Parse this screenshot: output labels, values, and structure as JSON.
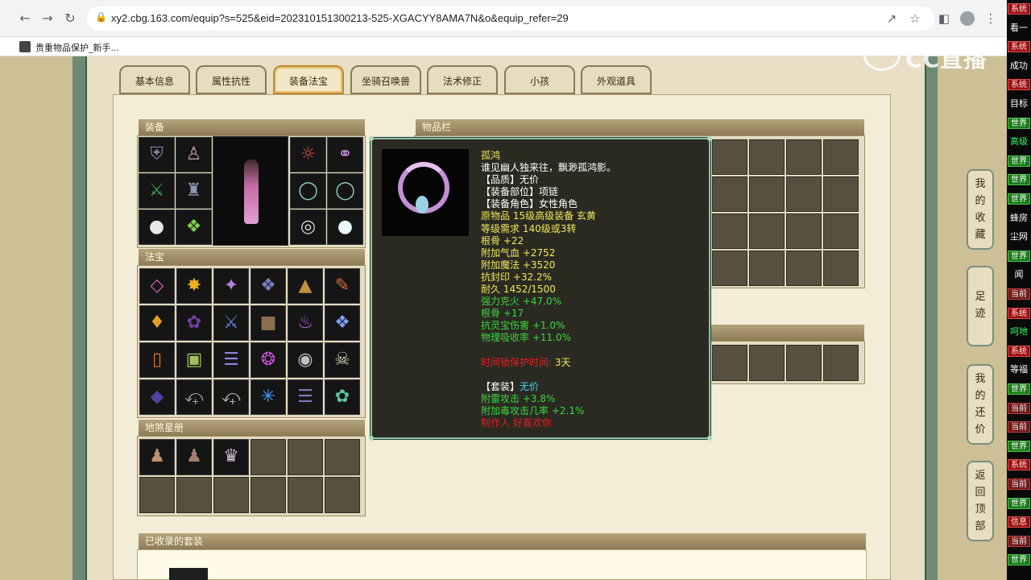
{
  "browser": {
    "url": "xy2.cbg.163.com/equip?s=525&eid=202310151300213-525-XGACYY8AMA7N&o&equip_refer=29",
    "bookmark": "贵重物品保护_新手..."
  },
  "tabs": [
    "基本信息",
    "属性抗性",
    "装备法宝",
    "坐骑召唤兽",
    "法术修正",
    "小孩",
    "外观道具"
  ],
  "active_tab": "装备法宝",
  "sections": {
    "equipment": "装备",
    "fabao": "法宝",
    "dishaxingce": "地煞星册",
    "inventory": "物品栏",
    "collected_sets": "已收录的套装"
  },
  "tooltip": {
    "name": "孤鸿",
    "desc": "谁见幽人独来往，飘渺孤鸿影。",
    "quality": "【品质】无价",
    "slot": "【装备部位】项链",
    "role": "【装备角色】女性角色",
    "origin": "原物品 15级高级装备 玄黄",
    "level_req": "等级需求 140级或3转",
    "stats_white": [
      "根骨 +22",
      "附加气血 +2752",
      "附加魔法 +3520",
      "抗封印 +32.2%",
      "耐久 1452/1500"
    ],
    "stats_green": [
      "强力克火 +47.0%",
      "根骨 +17",
      "抗灵宝伤害 +1.0%",
      "物理吸收率 +11.0%"
    ],
    "protect_label": "时间锁保护时间:",
    "protect_value": "3天",
    "set_label": "【套装】",
    "set_value": "无价",
    "set_stats": [
      "附雷攻击 +3.8%",
      "附加毒攻击几率 +2.1%"
    ],
    "maker": "制作人 好喜欢你"
  },
  "side_nav": {
    "favorites": [
      "我",
      "的",
      "收",
      "藏"
    ],
    "footprint": [
      "足",
      "迹"
    ],
    "bargain": [
      "我",
      "的",
      "还",
      "价"
    ],
    "top": [
      "返",
      "回",
      "顶",
      "部"
    ]
  },
  "watermark": "CC直播",
  "chat": {
    "items": [
      {
        "type": "ct-sys",
        "text": "系统"
      },
      {
        "type": "ct-txt",
        "text": "看一"
      },
      {
        "type": "ct-sys",
        "text": "系统"
      },
      {
        "type": "ct-txt",
        "text": "成功"
      },
      {
        "type": "ct-sys",
        "text": "系统"
      },
      {
        "type": "ct-txt",
        "text": "目标"
      },
      {
        "type": "ct-world",
        "text": "世界"
      },
      {
        "type": "ct-g",
        "text": "高级"
      },
      {
        "type": "ct-world",
        "text": "世界"
      },
      {
        "type": "ct-world",
        "text": "世界"
      },
      {
        "type": "ct-world",
        "text": "世界"
      },
      {
        "type": "ct-txt",
        "text": "蜂房"
      },
      {
        "type": "ct-txt",
        "text": "尘网"
      },
      {
        "type": "ct-world",
        "text": "世界"
      },
      {
        "type": "ct-txt",
        "text": "闻"
      },
      {
        "type": "ct-now",
        "text": "当前"
      },
      {
        "type": "ct-sys",
        "text": "系统"
      },
      {
        "type": "ct-g",
        "text": "呵地"
      },
      {
        "type": "ct-sys",
        "text": "系统"
      },
      {
        "type": "ct-txt",
        "text": "等福"
      },
      {
        "type": "ct-world",
        "text": "世界"
      },
      {
        "type": "ct-now",
        "text": "当前"
      },
      {
        "type": "ct-now",
        "text": "当前"
      },
      {
        "type": "ct-world",
        "text": "世界"
      },
      {
        "type": "ct-sys",
        "text": "系统"
      },
      {
        "type": "ct-now",
        "text": "当前"
      },
      {
        "type": "ct-world",
        "text": "世界"
      },
      {
        "type": "ct-sys",
        "text": "信息"
      },
      {
        "type": "ct-now",
        "text": "当前"
      },
      {
        "type": "ct-world",
        "text": "世界"
      }
    ]
  }
}
